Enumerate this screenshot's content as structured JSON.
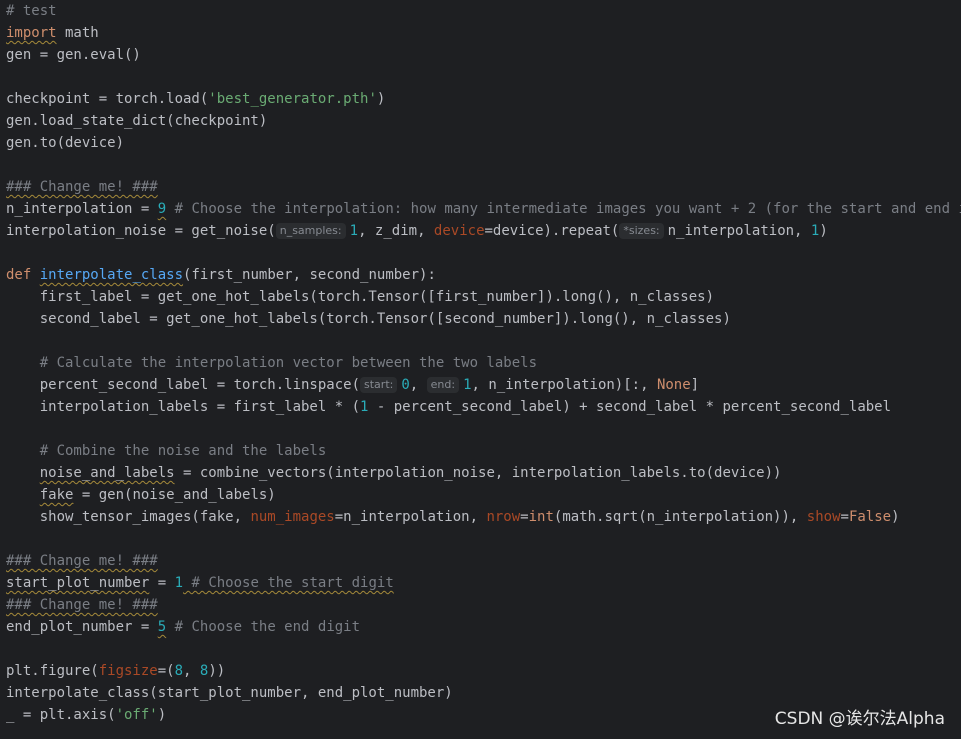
{
  "code": {
    "l1": "# test",
    "l2_kw": "import",
    "l2_rest": " math",
    "l3": "gen = gen.eval()",
    "l5_a": "checkpoint = torch.load(",
    "l5_str": "'best_generator.pth'",
    "l5_b": ")",
    "l6": "gen.load_state_dict(checkpoint)",
    "l7": "gen.to(device)",
    "l9": "### Change me! ###",
    "l10_a": "n_interpolation",
    "l10_b": " = ",
    "l10_num": "9",
    "l10_comment": " # Choose the interpolation: how many intermediate images you want + 2 (for the start and end image)",
    "l11_a": "interpolation_noise = get_noise(",
    "l11_hint1": "n_samples:",
    "l11_num1": "1",
    "l11_b": ", z_dim, ",
    "l11_param": "device",
    "l11_c": "=device).repeat(",
    "l11_hint2": "*sizes:",
    "l11_d": "n_interpolation, ",
    "l11_num2": "1",
    "l11_e": ")",
    "l13_kw": "def",
    "l13_fn": "interpolate_class",
    "l13_rest": "(first_number, second_number):",
    "l14": "    first_label = get_one_hot_labels(torch.Tensor([first_number]).long(), n_classes)",
    "l15": "    second_label = get_one_hot_labels(torch.Tensor([second_number]).long(), n_classes)",
    "l17": "    # Calculate the interpolation vector between the two labels",
    "l18_a": "    percent_second_label = torch.linspace(",
    "l18_hint1": "start:",
    "l18_num1": "0",
    "l18_b": ", ",
    "l18_hint2": "end:",
    "l18_num2": "1",
    "l18_c": ", n_interpolation)[:, ",
    "l18_kw": "None",
    "l18_d": "]",
    "l19_a": "    interpolation_labels = first_label * (",
    "l19_num": "1",
    "l19_b": " - percent_second_label) + second_label * percent_second_label",
    "l21": "    # Combine the noise and the labels",
    "l22_indent": "    ",
    "l22_var": "noise_and_labels",
    "l22_rest": " = combine_vectors(interpolation_noise, interpolation_labels.to(device))",
    "l23_indent": "    ",
    "l23_var": "fake",
    "l23_rest": " = gen(noise_and_labels)",
    "l24_a": "    show_tensor_images(fake, ",
    "l24_p1": "num_images",
    "l24_b": "=n_interpolation, ",
    "l24_p2": "nrow",
    "l24_c": "=",
    "l24_kw1": "int",
    "l24_d": "(math.sqrt(n_interpolation)), ",
    "l24_p3": "show",
    "l24_e": "=",
    "l24_kw2": "False",
    "l24_f": ")",
    "l26": "### Change me! ###",
    "l27_a": "start_plot_number",
    "l27_b": " = ",
    "l27_num": "1",
    "l27_comment": " # Choose the start digit",
    "l28": "### Change me! ###",
    "l29_a": "end_plot_number",
    "l29_b": " = ",
    "l29_num": "5",
    "l29_comment": " # Choose the end digit",
    "l31_a": "plt.figure(",
    "l31_param": "figsize",
    "l31_b": "=(",
    "l31_num1": "8",
    "l31_c": ", ",
    "l31_num2": "8",
    "l31_d": "))",
    "l32": "interpolate_class(start_plot_number, end_plot_number)",
    "l33_a": "_ = plt.axis(",
    "l33_str": "'off'",
    "l33_b": ")"
  },
  "watermark": "CSDN @诶尔法Alpha"
}
